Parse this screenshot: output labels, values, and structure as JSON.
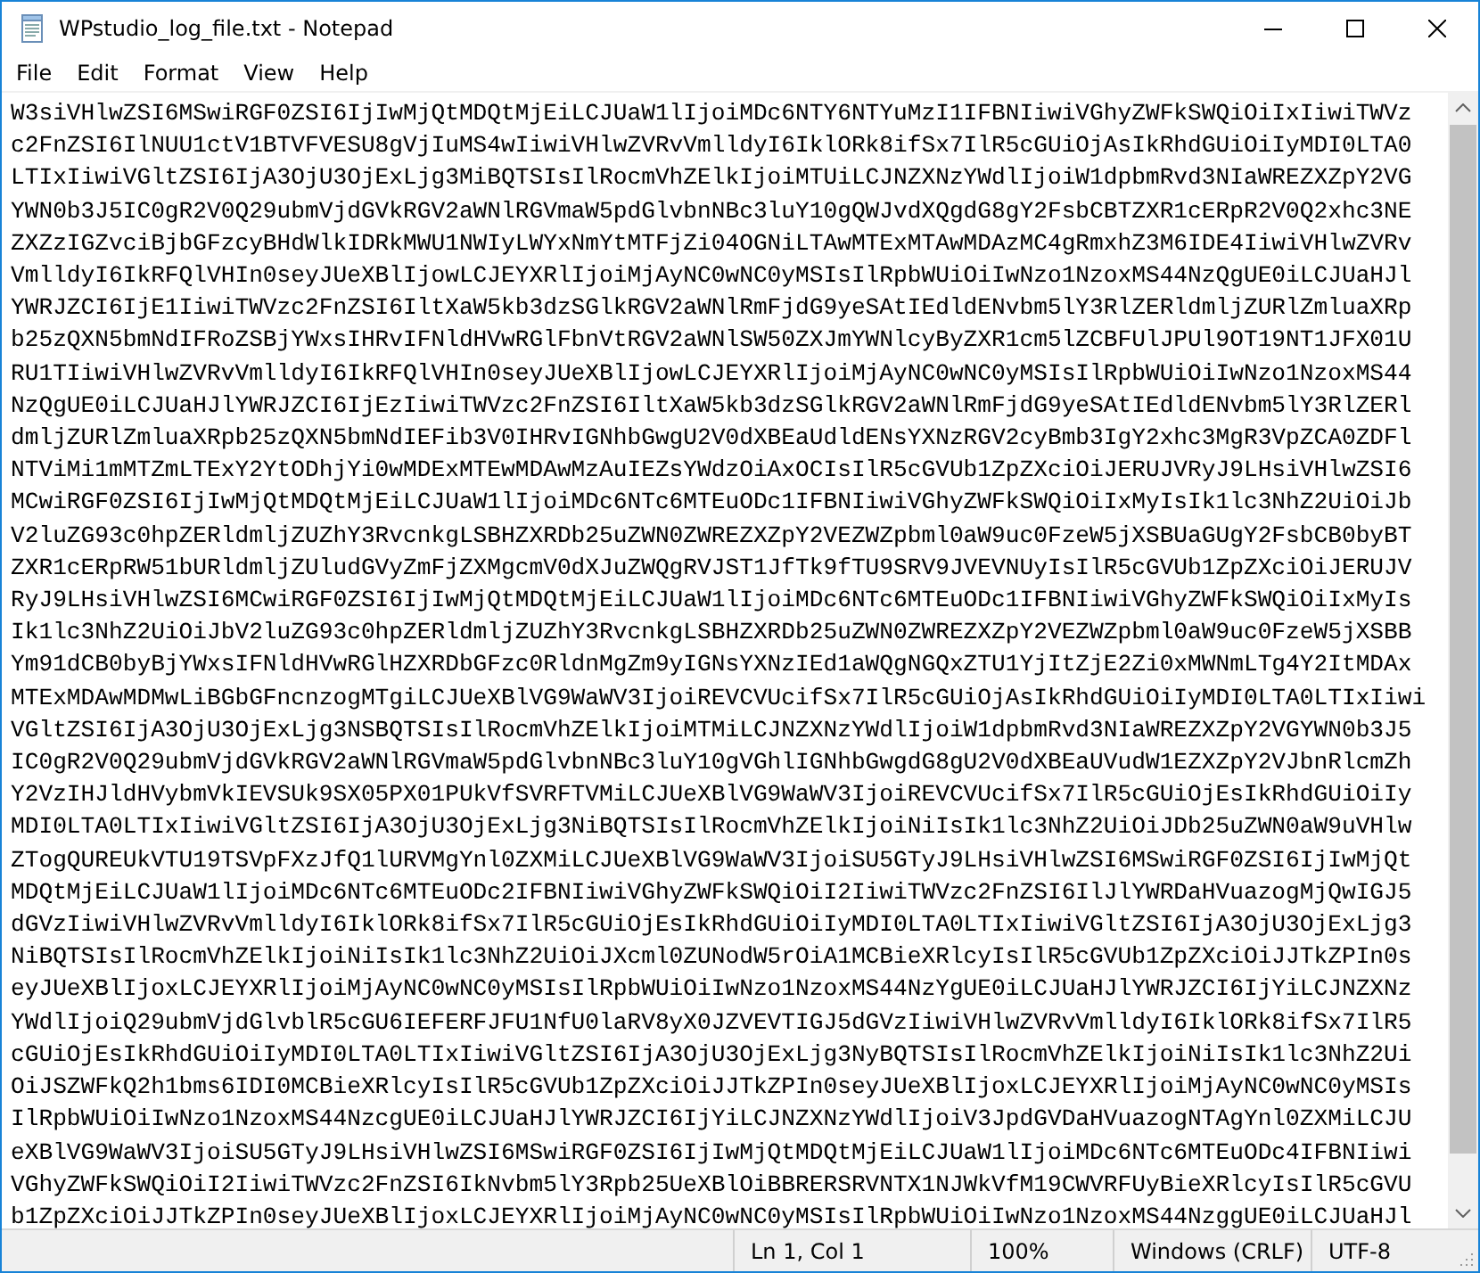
{
  "window": {
    "title": "WPstudio_log_file.txt - Notepad"
  },
  "menu": [
    "File",
    "Edit",
    "Format",
    "View",
    "Help"
  ],
  "editor": {
    "lines": [
      "W3siVHlwZSI6MSwiRGF0ZSI6IjIwMjQtMDQtMjEiLCJUaW1lIjoiMDc6NTY6NTYuMzI1IFBNIiwiVGhyZWFkSWQiOiIxIiwiTWVz",
      "c2FnZSI6IlNUU1ctV1BTVFVESU8gVjIuMS4wIiwiVHlwZVRvVmlldyI6IklORk8ifSx7IlR5cGUiOjAsIkRhdGUiOiIyMDI0LTA0",
      "LTIxIiwiVGltZSI6IjA3OjU3OjExLjg3MiBQTSIsIlRocmVhZElkIjoiMTUiLCJNZXNzYWdlIjoiW1dpbmRvd3NIaWREZXZpY2VG",
      "YWN0b3J5IC0gR2V0Q29ubmVjdGVkRGV2aWNlRGVmaW5pdGlvbnNBc3luY10gQWJvdXQgdG8gY2FsbCBTZXR1cERpR2V0Q2xhc3NE",
      "ZXZzIGZvciBjbGFzcyBHdWlkIDRkMWU1NWIyLWYxNmYtMTFjZi04OGNiLTAwMTExMTAwMDAzMC4gRmxhZ3M6IDE4IiwiVHlwZVRv",
      "VmlldyI6IkRFQlVHIn0seyJUeXBlIjowLCJEYXRlIjoiMjAyNC0wNC0yMSIsIlRpbWUiOiIwNzo1NzoxMS44NzQgUE0iLCJUaHJl",
      "YWRJZCI6IjE1IiwiTWVzc2FnZSI6IltXaW5kb3dzSGlkRGV2aWNlRmFjdG9yeSAtIEdldENvbm5lY3RlZERldmljZURlZmluaXRp",
      "b25zQXN5bmNdIFRoZSBjYWxsIHRvIFNldHVwRGlFbnVtRGV2aWNlSW50ZXJmYWNlcyByZXR1cm5lZCBFUlJPUl9OT19NT1JFX01U",
      "RU1TIiwiVHlwZVRvVmlldyI6IkRFQlVHIn0seyJUeXBlIjowLCJEYXRlIjoiMjAyNC0wNC0yMSIsIlRpbWUiOiIwNzo1NzoxMS44",
      "NzQgUE0iLCJUaHJlYWRJZCI6IjEzIiwiTWVzc2FnZSI6IltXaW5kb3dzSGlkRGV2aWNlRmFjdG9yeSAtIEdldENvbm5lY3RlZERl",
      "dmljZURlZmluaXRpb25zQXN5bmNdIEFib3V0IHRvIGNhbGwgU2V0dXBEaUdldENsYXNzRGV2cyBmb3IgY2xhc3MgR3VpZCA0ZDFl",
      "NTViMi1mMTZmLTExY2YtODhjYi0wMDExMTEwMDAwMzAuIEZsYWdzOiAxOCIsIlR5cGVUb1ZpZXciOiJERUJVRyJ9LHsiVHlwZSI6",
      "MCwiRGF0ZSI6IjIwMjQtMDQtMjEiLCJUaW1lIjoiMDc6NTc6MTEuODc1IFBNIiwiVGhyZWFkSWQiOiIxMyIsIk1lc3NhZ2UiOiJb",
      "V2luZG93c0hpZERldmljZUZhY3RvcnkgLSBHZXRDb25uZWN0ZWREZXZpY2VEZWZpbml0aW9uc0FzeW5jXSBUaGUgY2FsbCB0byBT",
      "ZXR1cERpRW51bURldmljZUludGVyZmFjZXMgcmV0dXJuZWQgRVJST1JfTk9fTU9SRV9JVEVNUyIsIlR5cGVUb1ZpZXciOiJERUJV",
      "RyJ9LHsiVHlwZSI6MCwiRGF0ZSI6IjIwMjQtMDQtMjEiLCJUaW1lIjoiMDc6NTc6MTEuODc1IFBNIiwiVGhyZWFkSWQiOiIxMyIs",
      "Ik1lc3NhZ2UiOiJbV2luZG93c0hpZERldmljZUZhY3RvcnkgLSBHZXRDb25uZWN0ZWREZXZpY2VEZWZpbml0aW9uc0FzeW5jXSBB",
      "Ym91dCB0byBjYWxsIFNldHVwRGlHZXRDbGFzc0RldnMgZm9yIGNsYXNzIEd1aWQgNGQxZTU1YjItZjE2Zi0xMWNmLTg4Y2ItMDAx",
      "MTExMDAwMDMwLiBGbGFncnzogMTgiLCJUeXBlVG9WaWV3IjoiREVCVUcifSx7IlR5cGUiOjAsIkRhdGUiOiIyMDI0LTA0LTIxIiwi",
      "VGltZSI6IjA3OjU3OjExLjg3NSBQTSIsIlRocmVhZElkIjoiMTMiLCJNZXNzYWdlIjoiW1dpbmRvd3NIaWREZXZpY2VGYWN0b3J5",
      "IC0gR2V0Q29ubmVjdGVkRGV2aWNlRGVmaW5pdGlvbnNBc3luY10gVGhlIGNhbGwgdG8gU2V0dXBEaUVudW1EZXZpY2VJbnRlcmZh",
      "Y2VzIHJldHVybmVkIEVSUk9SX05PX01PUkVfSVRFTVMiLCJUeXBlVG9WaWV3IjoiREVCVUcifSx7IlR5cGUiOjEsIkRhdGUiOiIy",
      "MDI0LTA0LTIxIiwiVGltZSI6IjA3OjU3OjExLjg3NiBQTSIsIlRocmVhZElkIjoiNiIsIk1lc3NhZ2UiOiJDb25uZWN0aW9uVHlw",
      "ZTogQUREUkVTU19TSVpFXzJfQ1lURVMgYnl0ZXMiLCJUeXBlVG9WaWV3IjoiSU5GTyJ9LHsiVHlwZSI6MSwiRGF0ZSI6IjIwMjQt",
      "MDQtMjEiLCJUaW1lIjoiMDc6NTc6MTEuODc2IFBNIiwiVGhyZWFkSWQiOiI2IiwiTWVzc2FnZSI6IlJlYWRDaHVuazogMjQwIGJ5",
      "dGVzIiwiVHlwZVRvVmlldyI6IklORk8ifSx7IlR5cGUiOjEsIkRhdGUiOiIyMDI0LTA0LTIxIiwiVGltZSI6IjA3OjU3OjExLjg3",
      "NiBQTSIsIlRocmVhZElkIjoiNiIsIk1lc3NhZ2UiOiJXcml0ZUNodW5rOiA1MCBieXRlcyIsIlR5cGVUb1ZpZXciOiJJTkZPIn0s",
      "eyJUeXBlIjoxLCJEYXRlIjoiMjAyNC0wNC0yMSIsIlRpbWUiOiIwNzo1NzoxMS44NzYgUE0iLCJUaHJlYWRJZCI6IjYiLCJNZXNz",
      "YWdlIjoiQ29ubmVjdGlvblR5cGU6IEFERFJFU1NfU0laRV8yX0JZVEVTIGJ5dGVzIiwiVHlwZVRvVmlldyI6IklORk8ifSx7IlR5",
      "cGUiOjEsIkRhdGUiOiIyMDI0LTA0LTIxIiwiVGltZSI6IjA3OjU3OjExLjg3NyBQTSIsIlRocmVhZElkIjoiNiIsIk1lc3NhZ2Ui",
      "OiJSZWFkQ2h1bms6IDI0MCBieXRlcyIsIlR5cGVUb1ZpZXciOiJJTkZPIn0seyJUeXBlIjoxLCJEYXRlIjoiMjAyNC0wNC0yMSIs",
      "IlRpbWUiOiIwNzo1NzoxMS44NzcgUE0iLCJUaHJlYWRJZCI6IjYiLCJNZXNzYWdlIjoiV3JpdGVDaHVuazogNTAgYnl0ZXMiLCJU",
      "eXBlVG9WaWV3IjoiSU5GTyJ9LHsiVHlwZSI6MSwiRGF0ZSI6IjIwMjQtMDQtMjEiLCJUaW1lIjoiMDc6NTc6MTEuODc4IFBNIiwi",
      "VGhyZWFkSWQiOiI2IiwiTWVzc2FnZSI6IkNvbm5lY3Rpb25UeXBlOiBBRERSRVNTX1NJWkVfM19CWVRFUyBieXRlcyIsIlR5cGVU",
      "b1ZpZXciOiJJTkZPIn0seyJUeXBlIjoxLCJEYXRlIjoiMjAyNC0wNC0yMSIsIlRpbWUiOiIwNzo1NzoxMS44NzggUE0iLCJUaHJl"
    ]
  },
  "status_bar": {
    "position": "Ln 1, Col 1",
    "zoom": "100%",
    "line_ending": "Windows (CRLF)",
    "encoding": "UTF-8"
  }
}
